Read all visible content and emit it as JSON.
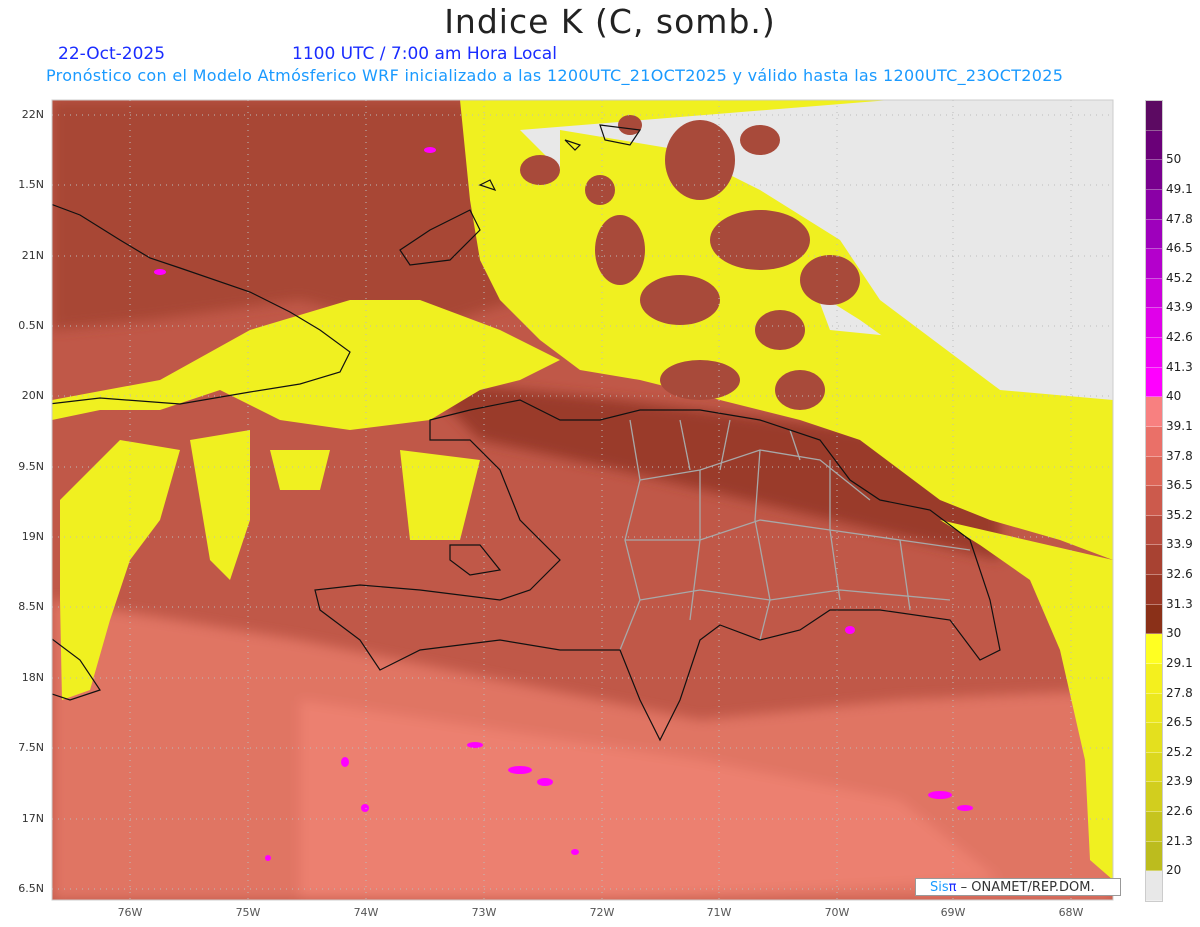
{
  "header": {
    "title": "Indice K (C, somb.)",
    "date": "22-Oct-2025",
    "time": "1100 UTC / 7:00 am Hora Local",
    "subtitle": "Pronóstico con el Modelo Atmósferico WRF inicializado a las 1200UTC_21OCT2025 y válido hasta las  1200UTC_23OCT2025"
  },
  "axes": {
    "lat_labels": [
      "22N",
      "1.5N",
      "21N",
      "0.5N",
      "20N",
      "9.5N",
      "19N",
      "8.5N",
      "18N",
      "7.5N",
      "17N",
      "6.5N"
    ],
    "lon_labels": [
      "76W",
      "75W",
      "74W",
      "73W",
      "72W",
      "71W",
      "70W",
      "69W",
      "68W"
    ]
  },
  "colorbar": {
    "labels": [
      "50",
      "49.1",
      "47.8",
      "46.5",
      "45.2",
      "43.9",
      "42.6",
      "41.3",
      "40",
      "39.1",
      "37.8",
      "36.5",
      "35.2",
      "33.9",
      "32.6",
      "31.3",
      "30",
      "29.1",
      "27.8",
      "26.5",
      "25.2",
      "23.9",
      "22.6",
      "21.3",
      "20"
    ],
    "colors": [
      "#5c0a62",
      "#6a0078",
      "#78008e",
      "#8a00a6",
      "#9e00bc",
      "#b400cc",
      "#cc00dc",
      "#e000ea",
      "#f000f4",
      "#ff00ff",
      "#f88080",
      "#ea7068",
      "#dd6658",
      "#cc5a4c",
      "#b84c3e",
      "#a84232",
      "#9a3826",
      "#8a3018",
      "#ffff22",
      "#f4f01e",
      "#ece81e",
      "#e4e01e",
      "#dcd81e",
      "#d2ce1e",
      "#c6c41e",
      "#bcbc1e",
      "#e8e8e8"
    ]
  },
  "credit": {
    "brand_a": "Sis",
    "brand_b": "π",
    "text": " –  ONAMET/REP.DOM."
  },
  "colors": {
    "title_blue": "#1a2cff",
    "subtitle_blue": "#1a9aff"
  }
}
